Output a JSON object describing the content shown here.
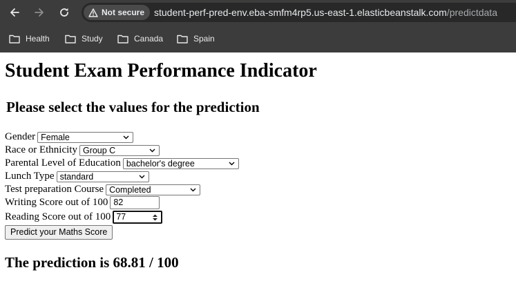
{
  "browser": {
    "security_label": "Not secure",
    "url_host": "student-perf-pred-env.eba-smfm4rp5.us-east-1.elasticbeanstalk.com",
    "url_path": "/predictdata",
    "bookmarks": [
      {
        "label": "Health",
        "icon": "folder-icon"
      },
      {
        "label": "Study",
        "icon": "folder-icon"
      },
      {
        "label": "Canada",
        "icon": "folder-icon"
      },
      {
        "label": "Spain",
        "icon": "folder-icon"
      }
    ]
  },
  "page": {
    "title": "Student Exam Performance Indicator",
    "subtitle": "Please select the values for the prediction",
    "form": {
      "gender": {
        "label": "Gender",
        "value": "Female"
      },
      "ethnicity": {
        "label": "Race or Ethnicity",
        "value": "Group C"
      },
      "parental_education": {
        "label": "Parental Level of Education",
        "value": "bachelor's degree"
      },
      "lunch": {
        "label": "Lunch Type",
        "value": "standard"
      },
      "test_prep": {
        "label": "Test preparation Course",
        "value": "Completed"
      },
      "writing_score": {
        "label": "Writing Score out of 100",
        "value": "82"
      },
      "reading_score": {
        "label": "Reading Score out of 100",
        "value": "77"
      },
      "submit_label": "Predict your Maths Score"
    },
    "result": "The prediction is 68.81 / 100"
  },
  "colors": {
    "chrome_bg": "#3c3c3c",
    "omnibox_bg": "#282828",
    "chrome_text": "#e8eaed",
    "page_bg": "#ffffff"
  }
}
